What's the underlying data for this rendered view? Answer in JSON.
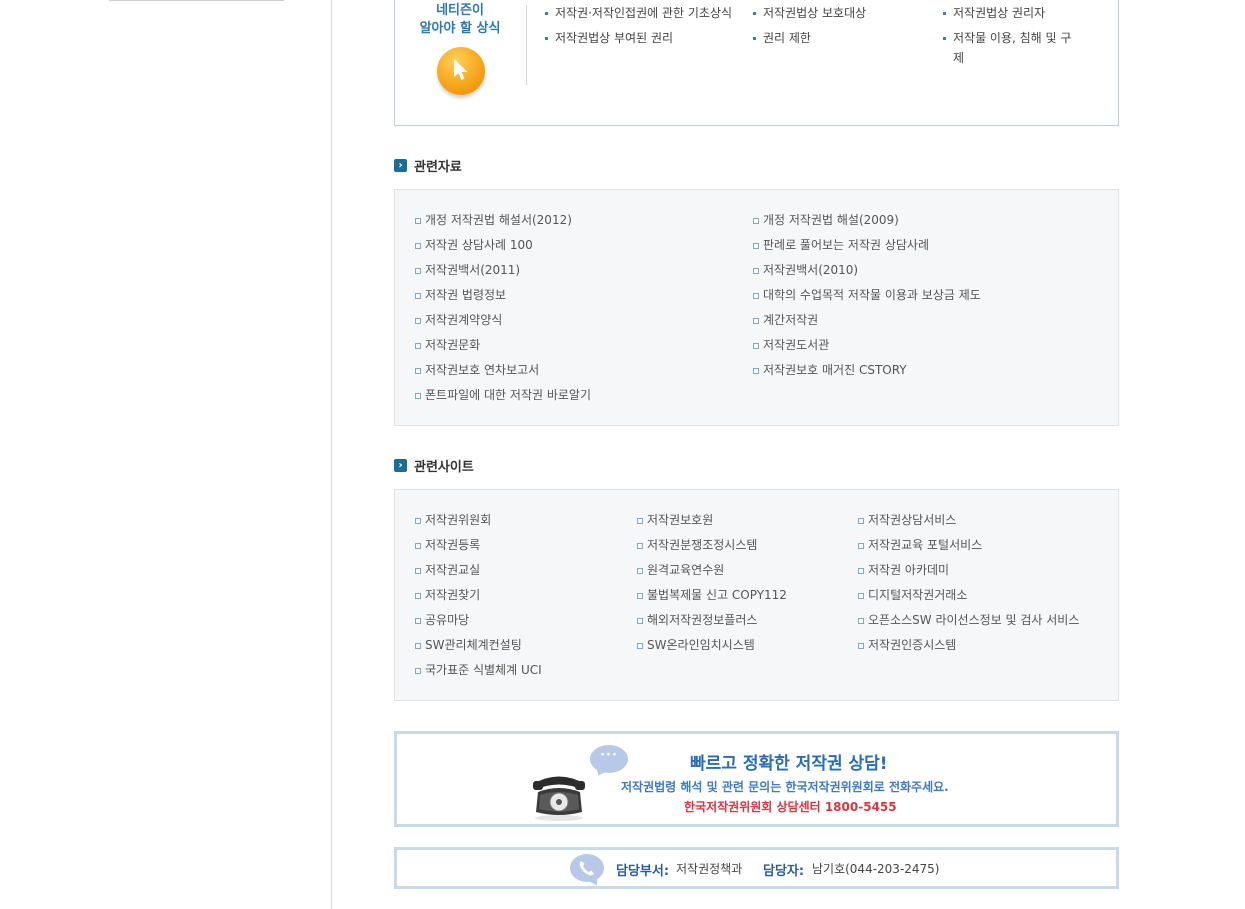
{
  "knowledge": {
    "title_line1": "네티즌이",
    "title_line2": "알아야 할 상식",
    "items": [
      "저작권·저작인접권에 관한 기초상식",
      "저작권법상 보호대상",
      "저작권법상 권리자",
      "저작권법상 부여된 권리",
      "권리 제한",
      "저작물 이용, 침해 및 구",
      "제"
    ]
  },
  "related_materials": {
    "title": "관련자료",
    "items": [
      "개정 저작권법 해설서(2012)",
      "개정 저작권법 해설(2009)",
      "저작권 상담사례 100",
      "판례로 풀어보는 저작권 상담사례",
      "저작권백서(2011)",
      "저작권백서(2010)",
      "저작권 법령정보",
      "대학의 수업목적 저작물 이용과 보상금 제도",
      "저작권계약양식",
      "계간저작권",
      "저작권문화",
      "저작권도서관",
      "저작권보호 연차보고서",
      "저작권보호 매거진 CSTORY",
      "폰트파일에 대한 저작권 바로알기"
    ]
  },
  "related_sites": {
    "title": "관련사이트",
    "items": [
      "저작권위원회",
      "저작권보호원",
      "저작권상담서비스",
      "저작권등록",
      "저작권분쟁조정시스템",
      "저작권교육 포털서비스",
      "저작권교실",
      "원격교육연수원",
      "저작권 아카데미",
      "저작권찾기",
      "불법복제물 신고 COPY112",
      "디지털저작권거래소",
      "공유마당",
      "해외저작권정보플러스",
      "오픈소스SW 라이선스정보 및 검사 서비스",
      "SW관리체계컨설팅",
      "SW온라인임치시스템",
      "저작권인증시스템",
      "국가표준 식별체계 UCI"
    ]
  },
  "consult": {
    "bubble": "···",
    "line1": "빠르고 정확한 저작권 상담!",
    "line2": "저작권법령 해석 및 관련 문의는 한국저작권위원회로 전화주세요.",
    "line3": "한국저작권위원회 상담센터 1800-5455"
  },
  "contact": {
    "dept_label": "담당부서:",
    "dept_value": "저작권정책과",
    "person_label": "담당자:",
    "person_value": "남기호(044-203-2475)"
  },
  "colors": {
    "accent_blue": "#2a79b6",
    "section_icon": "#1b6d95",
    "highlight_red": "#d9363e",
    "box_border": "#c9d9e7"
  }
}
